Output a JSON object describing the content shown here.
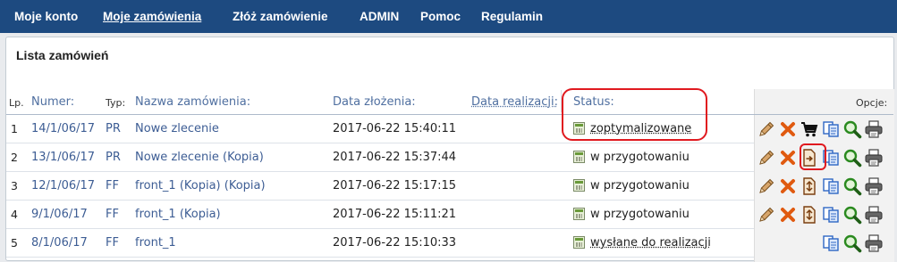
{
  "nav": {
    "items": [
      {
        "label": "Moje konto",
        "active": false
      },
      {
        "label": "Moje zamówienia",
        "active": true
      },
      {
        "label": "Złóż zamówienie",
        "active": false
      },
      {
        "label": "ADMIN",
        "active": false
      },
      {
        "label": "Pomoc",
        "active": false
      },
      {
        "label": "Regulamin",
        "active": false
      }
    ]
  },
  "panel": {
    "title": "Lista zamówień"
  },
  "table": {
    "headers": {
      "lp": "Lp.",
      "number": "Numer:",
      "type": "Typ:",
      "name": "Nazwa zamówienia:",
      "created": "Data złożenia:",
      "realization": "Data realizacji:",
      "status": "Status:",
      "options": "Opcje:"
    },
    "rows": [
      {
        "lp": "1",
        "number": "14/1/06/17",
        "type": "PR",
        "name": "Nowe zlecenie",
        "created": "2017-06-22 15:40:11",
        "status": "zoptymalizowane",
        "status_dotted": true,
        "actions": [
          "edit-pencil-icon",
          "delete-x-icon",
          "cart-icon",
          "copy-icon",
          "preview-icon",
          "print-icon"
        ]
      },
      {
        "lp": "2",
        "number": "13/1/06/17",
        "type": "PR",
        "name": "Nowe zlecenie (Kopia)",
        "created": "2017-06-22 15:37:44",
        "status": "w przygotowaniu",
        "status_dotted": false,
        "actions": [
          "edit-pencil-icon",
          "delete-x-icon",
          "send-document-icon",
          "copy-icon",
          "preview-icon",
          "print-icon"
        ]
      },
      {
        "lp": "3",
        "number": "12/1/06/17",
        "type": "FF",
        "name": "front_1 (Kopia) (Kopia)",
        "created": "2017-06-22 15:17:15",
        "status": "w przygotowaniu",
        "status_dotted": false,
        "actions": [
          "edit-pencil-icon",
          "delete-x-icon",
          "order-document-icon",
          "copy-icon",
          "preview-icon",
          "print-icon"
        ]
      },
      {
        "lp": "4",
        "number": "9/1/06/17",
        "type": "FF",
        "name": "front_1 (Kopia)",
        "created": "2017-06-22 15:11:21",
        "status": "w przygotowaniu",
        "status_dotted": false,
        "actions": [
          "edit-pencil-icon",
          "delete-x-icon",
          "order-document-icon",
          "copy-icon",
          "preview-icon",
          "print-icon"
        ]
      },
      {
        "lp": "5",
        "number": "8/1/06/17",
        "type": "FF",
        "name": "front_1",
        "created": "2017-06-22 15:10:33",
        "status": "wysłane do realizacji",
        "status_dotted": true,
        "actions": [
          "copy-icon",
          "preview-icon",
          "print-icon"
        ]
      }
    ]
  },
  "colors": {
    "nav_bg": "#1d4a80",
    "link": "#3d5d94",
    "annotation": "#e0191f"
  }
}
